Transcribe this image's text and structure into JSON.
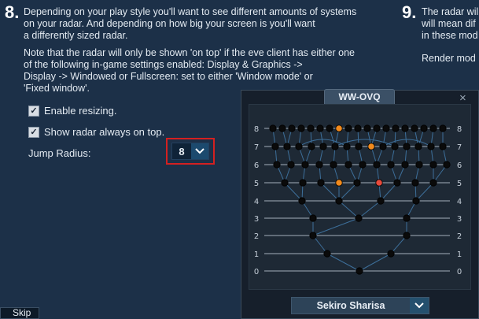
{
  "step8": {
    "number": "8.",
    "para1": "Depending on your play style you'll want to see different amounts of systems\non your radar. And depending on how big your screen is you'll want\na differently sized radar.",
    "para2": "Note that the radar will only be shown 'on top' if the eve client has either one\nof the following in-game settings enabled: Display & Graphics ->\nDisplay -> Windowed or Fullscreen: set to either 'Window mode' or\n'Fixed window'.",
    "enable_resizing": {
      "label": "Enable resizing.",
      "checked": true
    },
    "show_on_top": {
      "label": "Show radar always on top.",
      "checked": true
    },
    "jump_radius": {
      "label": "Jump Radius:",
      "value": "8"
    }
  },
  "step9": {
    "number": "9.",
    "text": "The radar wil\nwill mean dif\nin these mod",
    "render_mode": "Render mod"
  },
  "radar": {
    "title": "WW-OVQ",
    "close_glyph": "×",
    "row_labels": [
      "8",
      "7",
      "6",
      "5",
      "4",
      "3",
      "2",
      "1",
      "0"
    ],
    "character": "Sekiro Sharisa",
    "node_color": "#0a0a0a",
    "highlight_colors": {
      "orange": "#f28a1c",
      "current": "#e84a3c"
    }
  },
  "skip_button": "Skip"
}
